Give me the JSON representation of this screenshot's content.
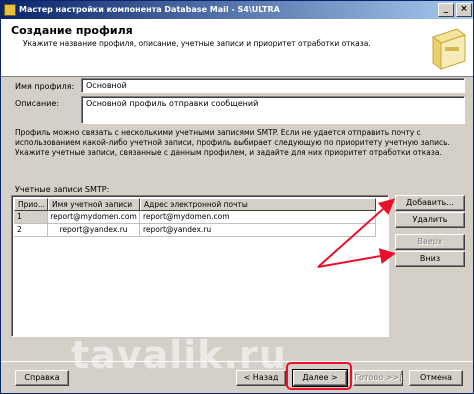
{
  "window": {
    "title": "Мастер настройки компонента Database Mail - S4\\ULTRA"
  },
  "header": {
    "title": "Создание профиля",
    "subtitle": "Укажите название профиля, описание, учетные записи и приоритет отработки отказа."
  },
  "form": {
    "profile_name_label": "Имя профиля:",
    "profile_name_value": "Основной",
    "description_label": "Описание:",
    "description_value": "Основной профиль отправки сообщений"
  },
  "info_text": "Профиль можно связать с несколькими учетными записями SMTP. Если не удается отправить почту с использованием какой-либо учетной записи, профиль выбирает следующую по приоритету учетную запись. Укажите учетные записи, связанные с данным профилем, и задайте для них приоритет отработки отказа.",
  "smtp": {
    "label": "Учетные записи SMTP:",
    "columns": [
      "Прио...",
      "Имя учетной записи",
      "Адрес электронной почты"
    ],
    "rows": [
      [
        "1",
        "report@mydomen.com",
        "report@mydomen.com"
      ],
      [
        "2",
        "report@yandex.ru",
        "report@yandex.ru"
      ]
    ]
  },
  "side_buttons": {
    "add": "Добавить...",
    "delete": "Удалить",
    "up": "Вверх",
    "down": "Вниз"
  },
  "footer": {
    "help": "Справка",
    "back": "< Назад",
    "next": "Далее >",
    "finish": "Готово >>|",
    "cancel": "Отмена"
  },
  "watermark": "tavalik.ru",
  "colors": {
    "annotation_red": "#e8102a"
  }
}
